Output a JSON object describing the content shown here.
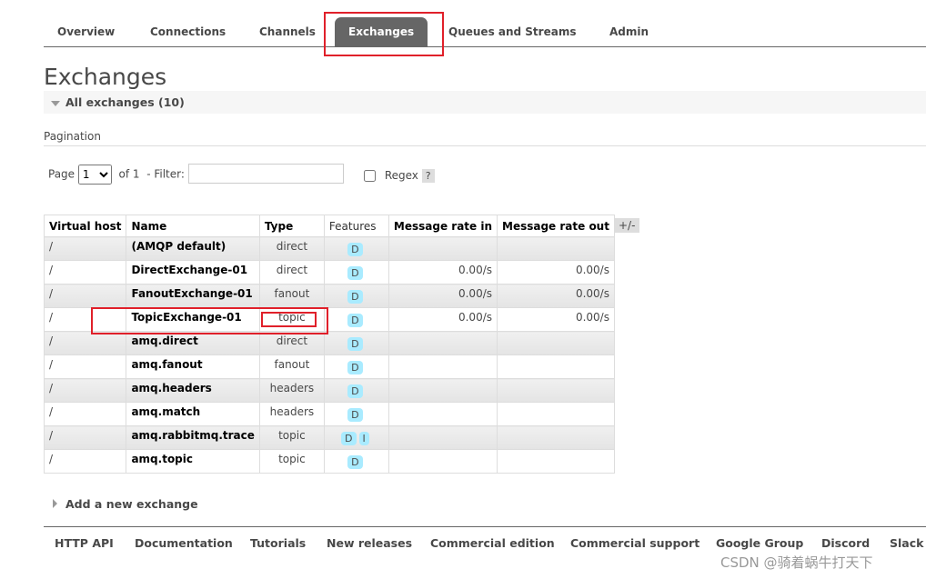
{
  "nav": {
    "tabs": [
      {
        "label": "Overview",
        "active": false
      },
      {
        "label": "Connections",
        "active": false
      },
      {
        "label": "Channels",
        "active": false
      },
      {
        "label": "Exchanges",
        "active": true
      },
      {
        "label": "Queues and Streams",
        "active": false
      },
      {
        "label": "Admin",
        "active": false
      }
    ]
  },
  "page_title": "Exchanges",
  "section_title": "All exchanges (10)",
  "pagination": {
    "label": "Pagination",
    "page_label": "Page",
    "page_value": "1",
    "of_label": "of 1",
    "filter_label": "- Filter:",
    "filter_value": "",
    "regex_label": "Regex",
    "regex_checked": false,
    "help": "?"
  },
  "table": {
    "columns": [
      "Virtual host",
      "Name",
      "Type",
      "Features",
      "Message rate in",
      "Message rate out"
    ],
    "toggle_columns": "+/-",
    "rows": [
      {
        "vhost": "/",
        "name": "(AMQP default)",
        "type": "direct",
        "features": [
          "D"
        ],
        "rate_in": "",
        "rate_out": ""
      },
      {
        "vhost": "/",
        "name": "DirectExchange-01",
        "type": "direct",
        "features": [
          "D"
        ],
        "rate_in": "0.00/s",
        "rate_out": "0.00/s"
      },
      {
        "vhost": "/",
        "name": "FanoutExchange-01",
        "type": "fanout",
        "features": [
          "D"
        ],
        "rate_in": "0.00/s",
        "rate_out": "0.00/s"
      },
      {
        "vhost": "/",
        "name": "TopicExchange-01",
        "type": "topic",
        "features": [
          "D"
        ],
        "rate_in": "0.00/s",
        "rate_out": "0.00/s"
      },
      {
        "vhost": "/",
        "name": "amq.direct",
        "type": "direct",
        "features": [
          "D"
        ],
        "rate_in": "",
        "rate_out": ""
      },
      {
        "vhost": "/",
        "name": "amq.fanout",
        "type": "fanout",
        "features": [
          "D"
        ],
        "rate_in": "",
        "rate_out": ""
      },
      {
        "vhost": "/",
        "name": "amq.headers",
        "type": "headers",
        "features": [
          "D"
        ],
        "rate_in": "",
        "rate_out": ""
      },
      {
        "vhost": "/",
        "name": "amq.match",
        "type": "headers",
        "features": [
          "D"
        ],
        "rate_in": "",
        "rate_out": ""
      },
      {
        "vhost": "/",
        "name": "amq.rabbitmq.trace",
        "type": "topic",
        "features": [
          "D",
          "I"
        ],
        "rate_in": "",
        "rate_out": ""
      },
      {
        "vhost": "/",
        "name": "amq.topic",
        "type": "topic",
        "features": [
          "D"
        ],
        "rate_in": "",
        "rate_out": ""
      }
    ]
  },
  "add_exchange": "Add a new exchange",
  "footer": {
    "links": [
      "HTTP API",
      "Documentation",
      "Tutorials",
      "New releases",
      "Commercial edition",
      "Commercial support",
      "Google Group",
      "Discord",
      "Slack"
    ]
  },
  "watermark": "CSDN @骑着蜗牛打天下",
  "colors": {
    "active_tab": "#666666",
    "highlight_box": "#e0202a",
    "feature_badge": "#a9ebff"
  }
}
